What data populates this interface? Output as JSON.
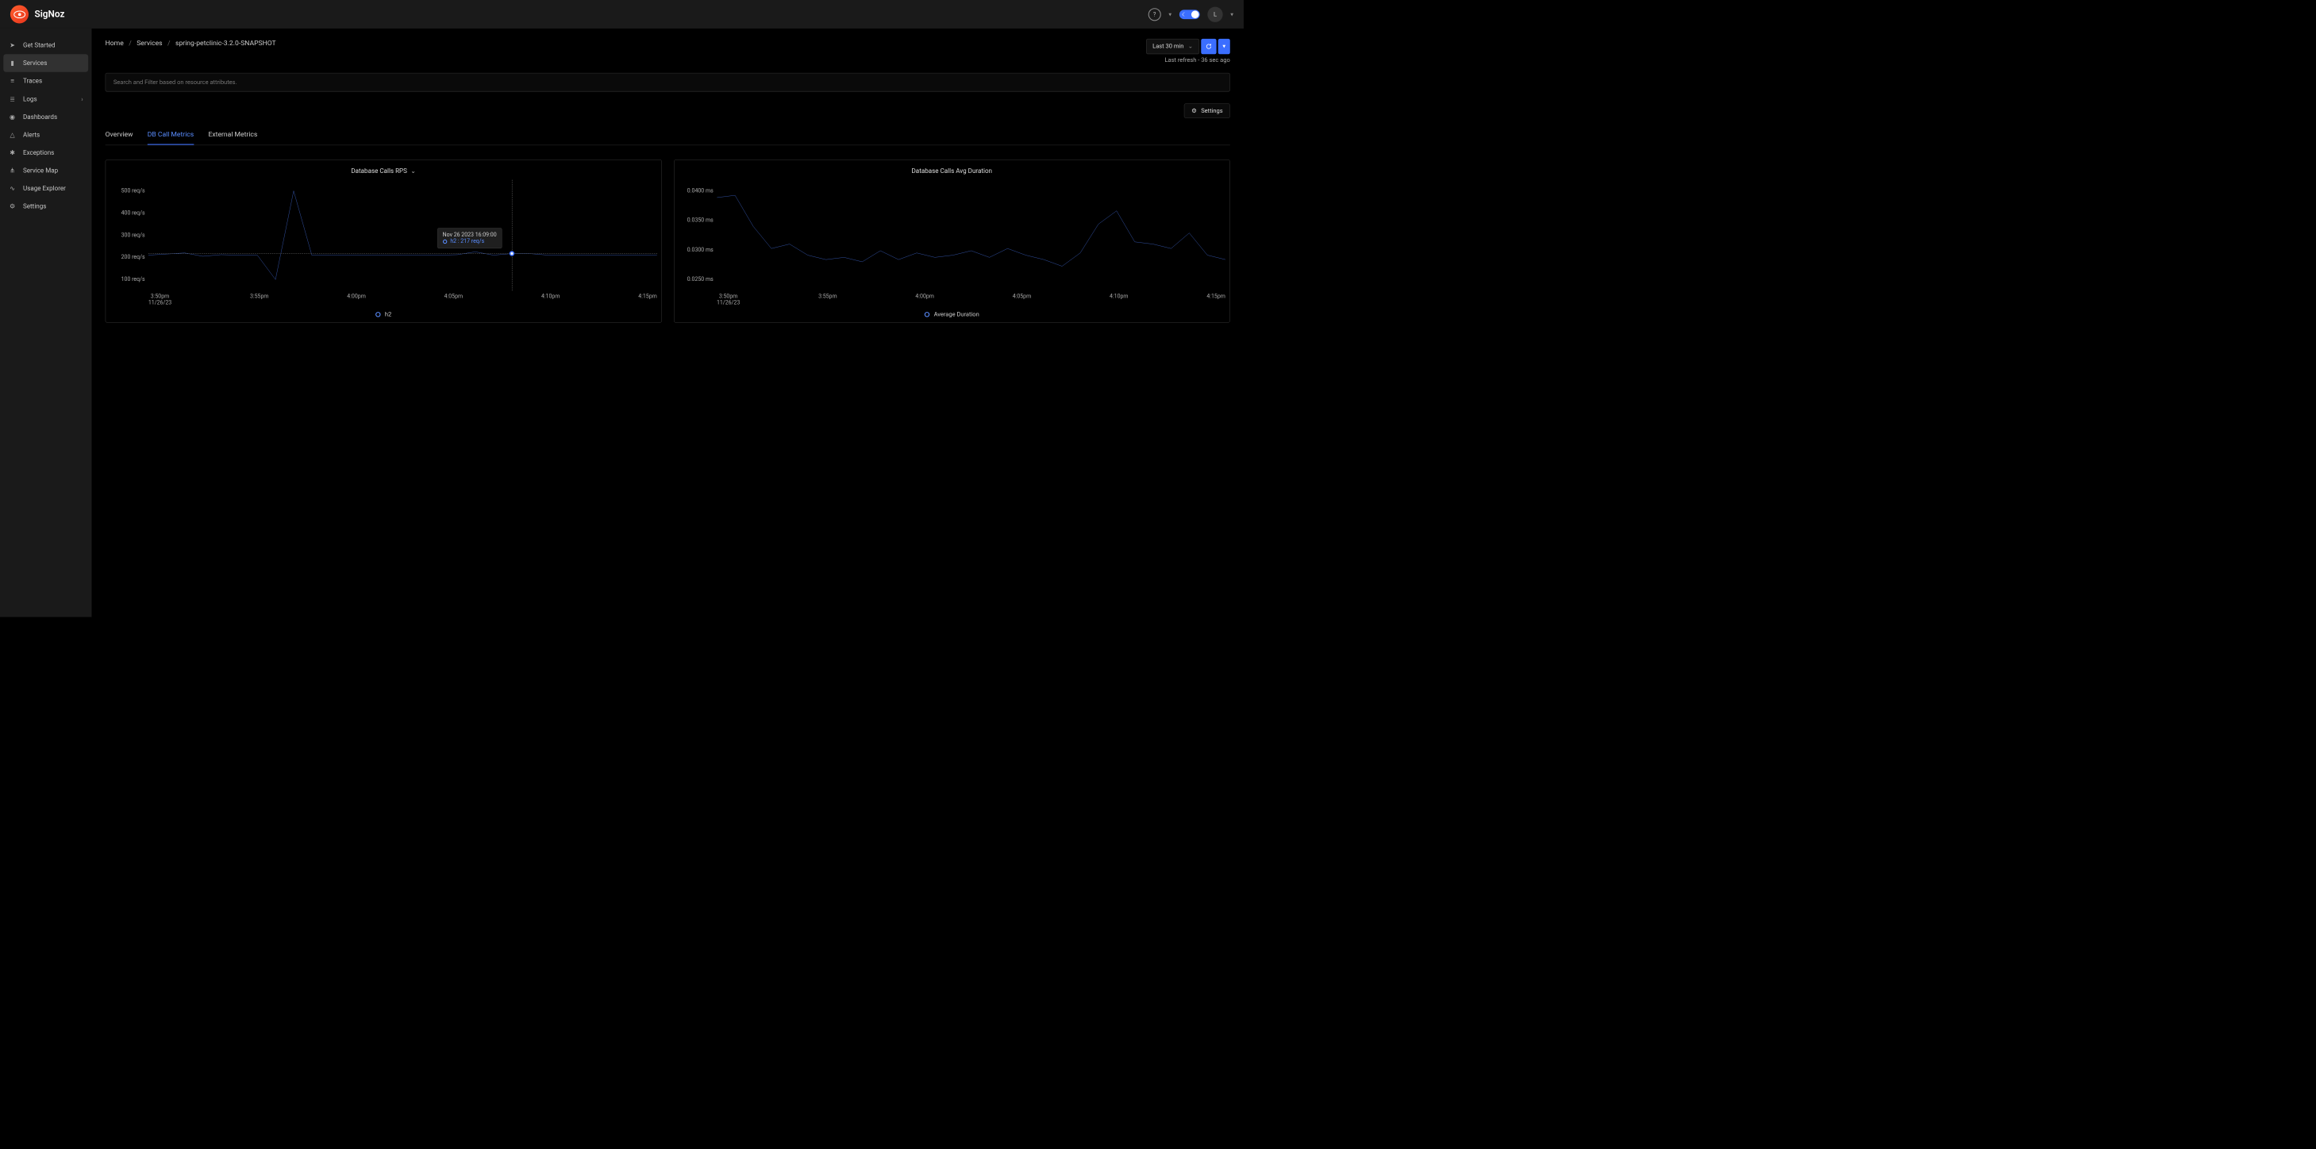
{
  "brand": {
    "name": "SigNoz"
  },
  "topbar": {
    "avatar_initial": "L"
  },
  "sidebar": {
    "items": [
      {
        "label": "Get Started",
        "icon": "rocket"
      },
      {
        "label": "Services",
        "icon": "bar-chart",
        "active": true
      },
      {
        "label": "Traces",
        "icon": "menu"
      },
      {
        "label": "Logs",
        "icon": "align-left",
        "expandable": true
      },
      {
        "label": "Dashboards",
        "icon": "gauge"
      },
      {
        "label": "Alerts",
        "icon": "bell"
      },
      {
        "label": "Exceptions",
        "icon": "bug"
      },
      {
        "label": "Service Map",
        "icon": "network"
      },
      {
        "label": "Usage Explorer",
        "icon": "line-chart"
      },
      {
        "label": "Settings",
        "icon": "gear"
      }
    ]
  },
  "breadcrumbs": {
    "home": "Home",
    "services": "Services",
    "current": "spring-petclinic-3.2.0-SNAPSHOT"
  },
  "time": {
    "range_label": "Last 30 min",
    "last_refresh": "Last refresh - 36 sec ago"
  },
  "search": {
    "placeholder": "Search and Filter based on resource attributes."
  },
  "settings_btn": "Settings",
  "tabs": {
    "overview": "Overview",
    "db": "DB Call Metrics",
    "external": "External Metrics"
  },
  "chart_data": [
    {
      "type": "line",
      "title": "Database Calls RPS",
      "ylabel": "req/s",
      "ylim": [
        100,
        500
      ],
      "y_ticks": [
        "500 req/s",
        "400 req/s",
        "300 req/s",
        "200 req/s",
        "100 req/s"
      ],
      "x_ticks": [
        {
          "top": "3:50pm",
          "bottom": "11/26/23"
        },
        {
          "top": "3:55pm"
        },
        {
          "top": "4:00pm"
        },
        {
          "top": "4:05pm"
        },
        {
          "top": "4:10pm"
        },
        {
          "top": "4:15pm"
        }
      ],
      "series": [
        {
          "name": "h2",
          "x": [
            "3:49",
            "3:50",
            "3:51",
            "3:52",
            "3:53",
            "3:54",
            "3:55",
            "3:56",
            "3:57",
            "3:58",
            "3:59",
            "4:00",
            "4:01",
            "4:02",
            "4:03",
            "4:04",
            "4:05",
            "4:06",
            "4:07",
            "4:08",
            "4:09",
            "4:10",
            "4:11",
            "4:12",
            "4:13",
            "4:14",
            "4:15",
            "4:16",
            "4:17"
          ],
          "values": [
            210,
            215,
            220,
            205,
            212,
            210,
            210,
            100,
            500,
            210,
            210,
            210,
            210,
            210,
            210,
            210,
            210,
            212,
            225,
            210,
            217,
            217,
            210,
            210,
            210,
            210,
            210,
            210,
            210
          ]
        }
      ],
      "legend": "h2",
      "tooltip": {
        "timestamp": "Nov 26 2023 16:09:00",
        "series_label": "h2 : 217 req/s"
      },
      "hover_index": 20
    },
    {
      "type": "line",
      "title": "Database Calls Avg Duration",
      "ylabel": "ms",
      "ylim": [
        0.0225,
        0.0425
      ],
      "y_ticks": [
        "0.0400 ms",
        "0.0350 ms",
        "0.0300 ms",
        "0.0250 ms"
      ],
      "x_ticks": [
        {
          "top": "3:50pm",
          "bottom": "11/26/23"
        },
        {
          "top": "3:55pm"
        },
        {
          "top": "4:00pm"
        },
        {
          "top": "4:05pm"
        },
        {
          "top": "4:10pm"
        },
        {
          "top": "4:15pm"
        }
      ],
      "series": [
        {
          "name": "Average Duration",
          "x": [
            "3:49",
            "3:50",
            "3:51",
            "3:52",
            "3:53",
            "3:54",
            "3:55",
            "3:56",
            "3:57",
            "3:58",
            "3:59",
            "4:00",
            "4:01",
            "4:02",
            "4:03",
            "4:04",
            "4:05",
            "4:06",
            "4:07",
            "4:08",
            "4:09",
            "4:10",
            "4:11",
            "4:12",
            "4:13",
            "4:14",
            "4:15",
            "4:16",
            "4:17"
          ],
          "values": [
            0.041,
            0.0415,
            0.0345,
            0.0295,
            0.0305,
            0.028,
            0.027,
            0.0275,
            0.0265,
            0.029,
            0.027,
            0.0285,
            0.0275,
            0.028,
            0.029,
            0.0275,
            0.0295,
            0.028,
            0.027,
            0.0255,
            0.0285,
            0.035,
            0.038,
            0.031,
            0.0305,
            0.0295,
            0.033,
            0.028,
            0.027
          ]
        }
      ],
      "legend": "Average Duration"
    }
  ]
}
